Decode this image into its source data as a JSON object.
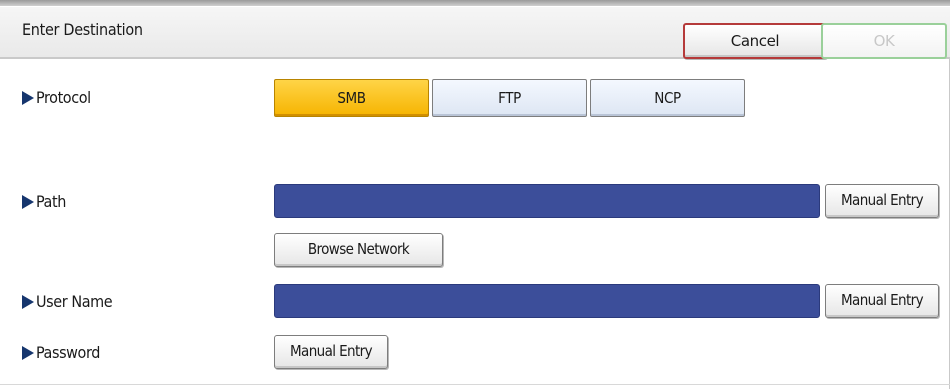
{
  "header": {
    "title": "Enter Destination",
    "cancel_label": "Cancel",
    "ok_label": "OK"
  },
  "protocol": {
    "label": "Protocol",
    "options": [
      "SMB",
      "FTP",
      "NCP"
    ],
    "selected": "SMB"
  },
  "path": {
    "label": "Path",
    "value": "",
    "manual_entry_label": "Manual Entry",
    "browse_label": "Browse Network"
  },
  "user_name": {
    "label": "User Name",
    "value": "",
    "manual_entry_label": "Manual Entry"
  },
  "password": {
    "label": "Password",
    "manual_entry_label": "Manual Entry"
  },
  "colors": {
    "selected_option": "#f6b400",
    "input_field": "#3c4e9a",
    "cancel_border": "#b53a3a",
    "ok_border": "#9ad09a",
    "row_arrow": "#16366e"
  }
}
